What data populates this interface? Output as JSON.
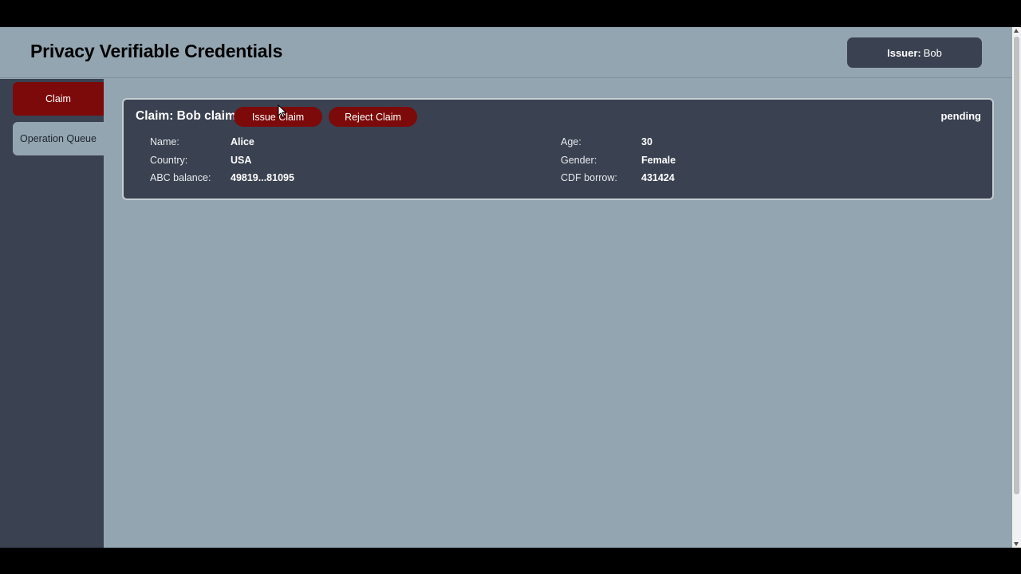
{
  "header": {
    "title": "Privacy Verifiable Credentials",
    "issuer_label": "Issuer:",
    "issuer_name": "Bob"
  },
  "sidebar": {
    "items": [
      {
        "label": "Claim",
        "active": true
      },
      {
        "label": "Operation Queue",
        "active": false
      }
    ]
  },
  "claim": {
    "title": "Claim: Bob claim",
    "issue_label": "Issue Claim",
    "reject_label": "Reject Claim",
    "status": "pending",
    "fields_left": [
      {
        "label": "Name:",
        "value": "Alice"
      },
      {
        "label": "Country:",
        "value": "USA"
      },
      {
        "label": "ABC balance:",
        "value": "49819...81095"
      }
    ],
    "fields_right": [
      {
        "label": "Age:",
        "value": "30"
      },
      {
        "label": "Gender:",
        "value": "Female"
      },
      {
        "label": "CDF borrow:",
        "value": "431424"
      }
    ]
  },
  "colors": {
    "accent": "#7c0a0a",
    "panel": "#3a4150",
    "background": "#93a5b0"
  }
}
